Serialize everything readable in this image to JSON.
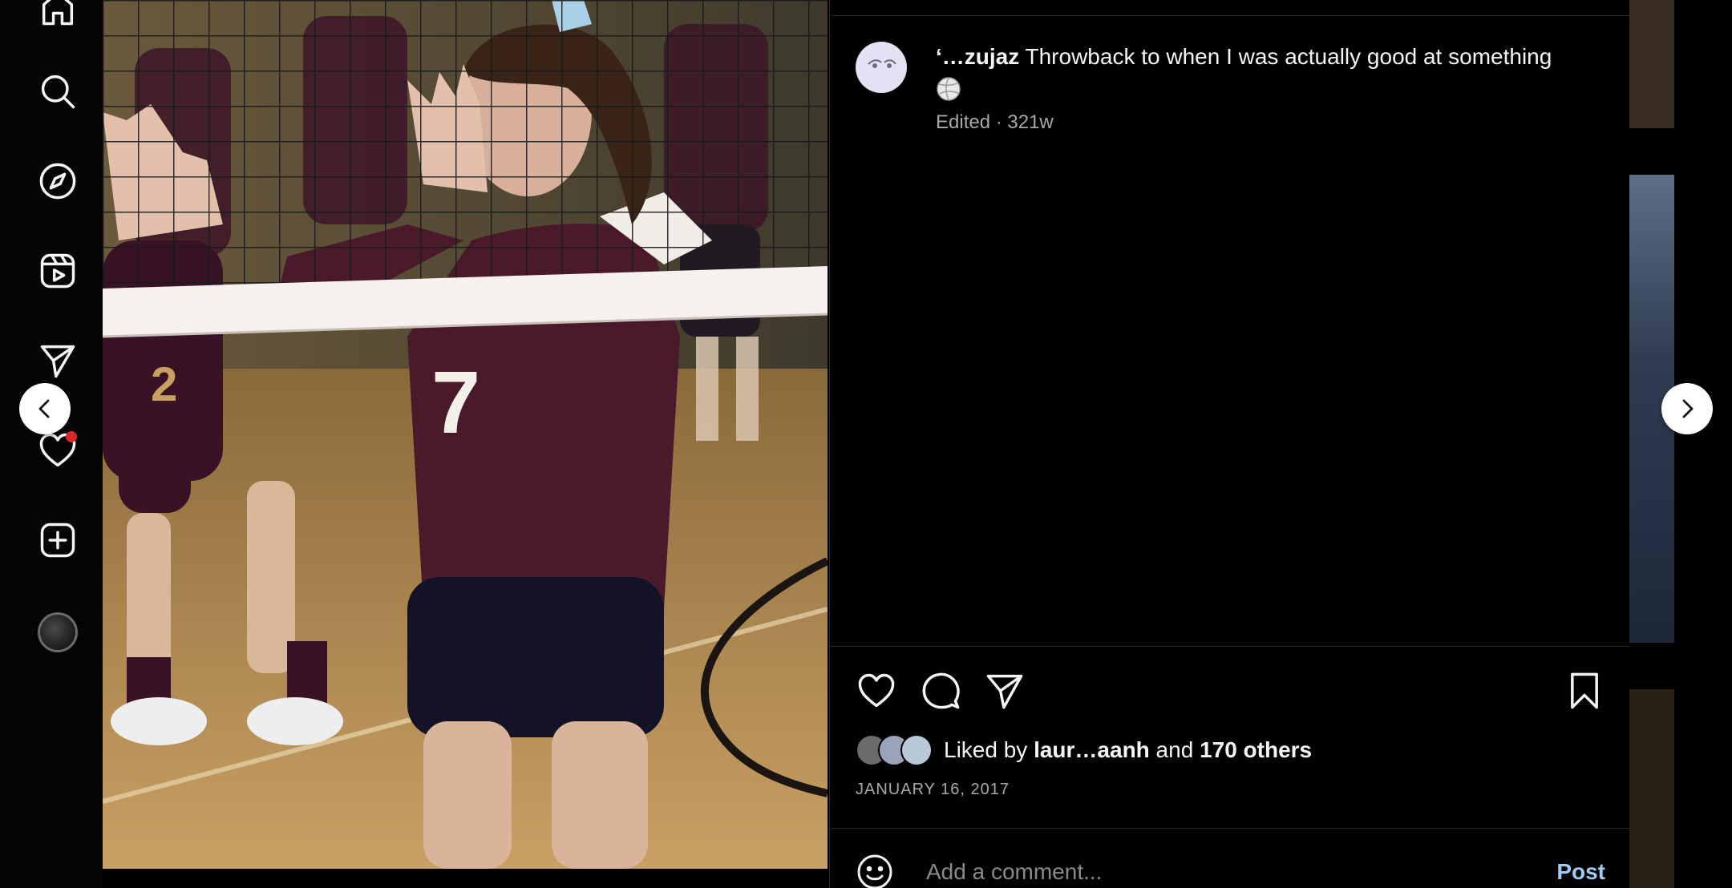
{
  "post": {
    "username": "‘…zujaz",
    "caption": " Throwback to when I was actually good at something",
    "caption_emoji": "volleyball-emoji",
    "edited_label": "Edited",
    "separator": " · ",
    "age": "321w",
    "liked_by_prefix": "Liked by ",
    "liked_by_user": "laur…aanh",
    "liked_by_mid": " and ",
    "liked_by_others": "170 others",
    "date": "JANUARY 16, 2017"
  },
  "comment": {
    "placeholder": "Add a comment...",
    "post_label": "Post"
  },
  "photo": {
    "subject": "volleyball player in maroon jersey number 7 at the net",
    "jersey_number": "7",
    "bg_jersey_number": "2"
  },
  "nav": {
    "icons": [
      "home-icon",
      "search-icon",
      "explore-icon",
      "reels-icon",
      "messages-icon",
      "notifications-icon",
      "create-icon",
      "profile-avatar"
    ],
    "has_notification": true
  },
  "colors": {
    "background": "#000000",
    "text": "#f5f5f5",
    "muted": "#a8a8a8",
    "link_blue": "#9ecbf5",
    "divider": "#262626",
    "notification_red": "#e0242c",
    "jersey_maroon": "#4a1a2a"
  }
}
